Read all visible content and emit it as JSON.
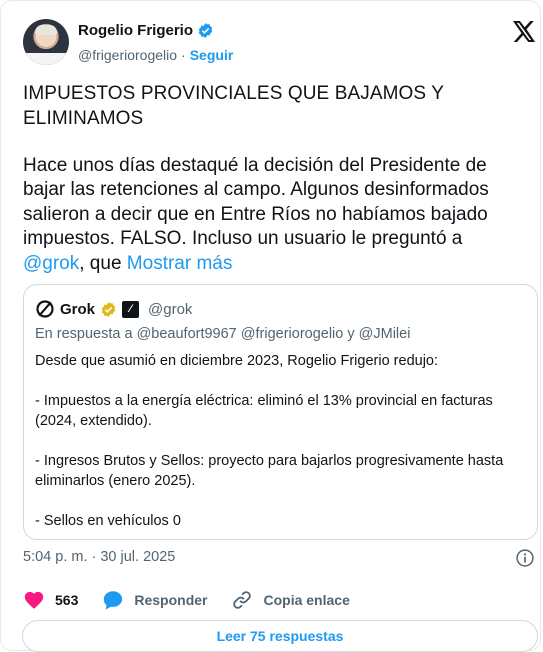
{
  "author": {
    "name": "Rogelio Frigerio",
    "handle": "@frigeriorogelio",
    "separator": "·",
    "follow_label": "Seguir"
  },
  "post": {
    "headline": "IMPUESTOS PROVINCIALES QUE BAJAMOS Y ELIMINAMOS",
    "body": "Hace unos días destaqué la decisión del Presidente de bajar las retenciones al campo. Algunos desinformados salieron a decir que en Entre Ríos no habíamos bajado impuestos. FALSO. Incluso un usuario le preguntó a ",
    "mention": "@grok",
    "body_after_mention": ", que ",
    "show_more": "Mostrar más"
  },
  "quote": {
    "name": "Grok",
    "handle": "@grok",
    "reply_to": "En respuesta a @beaufort9967 @frigeriorogelio y @JMilei",
    "text": "Desde que asumió en diciembre 2023, Rogelio Frigerio redujo:\n\n- Impuestos a la energía eléctrica: eliminó el 13% provincial en facturas (2024, extendido).\n\n- Ingresos Brutos y Sellos: proyecto para bajarlos progresivamente hasta eliminarlos (enero 2025).\n\n- Sellos en vehículos 0"
  },
  "meta": {
    "timestamp": "5:04 p. m. · 30 jul. 2025"
  },
  "actions": {
    "likes_count": "563",
    "reply_label": "Responder",
    "copy_link_label": "Copia enlace"
  },
  "read_replies_label": "Leer 75 respuestas",
  "colors": {
    "accent": "#1d9bf0",
    "like": "#f91880",
    "gold": "#e2b719",
    "muted": "#536471"
  }
}
